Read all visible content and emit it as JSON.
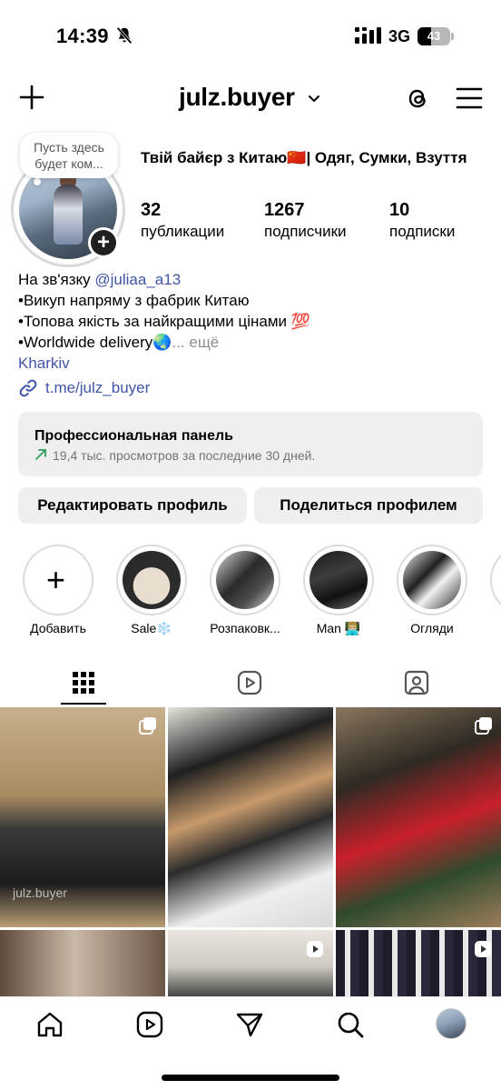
{
  "status": {
    "time": "14:39",
    "network": "3G",
    "battery": "43",
    "battery_level": 0.43
  },
  "header": {
    "username": "julz.buyer"
  },
  "profile": {
    "note": "Пусть здесь будет ком...",
    "title": "Твій байєр з Китаю🇨🇳| Одяг, Сумки, Взуття",
    "stats": [
      {
        "value": "32",
        "label": "публикации"
      },
      {
        "value": "1267",
        "label": "подписчики"
      },
      {
        "value": "10",
        "label": "подписки"
      }
    ],
    "bio_prefix": "На зв'язку ",
    "bio_mention": "@juliaa_a13",
    "bio_lines": [
      "•Викуп напряму з фабрик Китаю",
      "•Топова якість за найкращими цінами 💯",
      "•Worldwide delivery🌏"
    ],
    "more": "... ещё",
    "city": "Kharkiv",
    "link": "t.me/julz_buyer"
  },
  "panel": {
    "title": "Профессиональная панель",
    "subtitle": "19,4 тыс. просмотров за последние 30 дней."
  },
  "buttons": {
    "edit": "Редактировать профиль",
    "share": "Поделиться профилем"
  },
  "highlights": [
    {
      "label": "Добавить"
    },
    {
      "label": "Sale❄️"
    },
    {
      "label": "Розпаковк..."
    },
    {
      "label": "Man 👨🏼‍💻"
    },
    {
      "label": "Огляди"
    }
  ],
  "grid": {
    "watermark": "julz.buyer"
  },
  "colors": {
    "link": "#3f55a8",
    "muted": "#737373",
    "panel_bg": "#efefef"
  },
  "icons": [
    "plus-icon",
    "chevron-down-icon",
    "threads-icon",
    "menu-icon",
    "link-icon",
    "trend-arrow-icon",
    "grid-icon",
    "reels-icon",
    "tagged-icon",
    "home-icon",
    "reels-nav-icon",
    "direct-icon",
    "search-icon"
  ]
}
